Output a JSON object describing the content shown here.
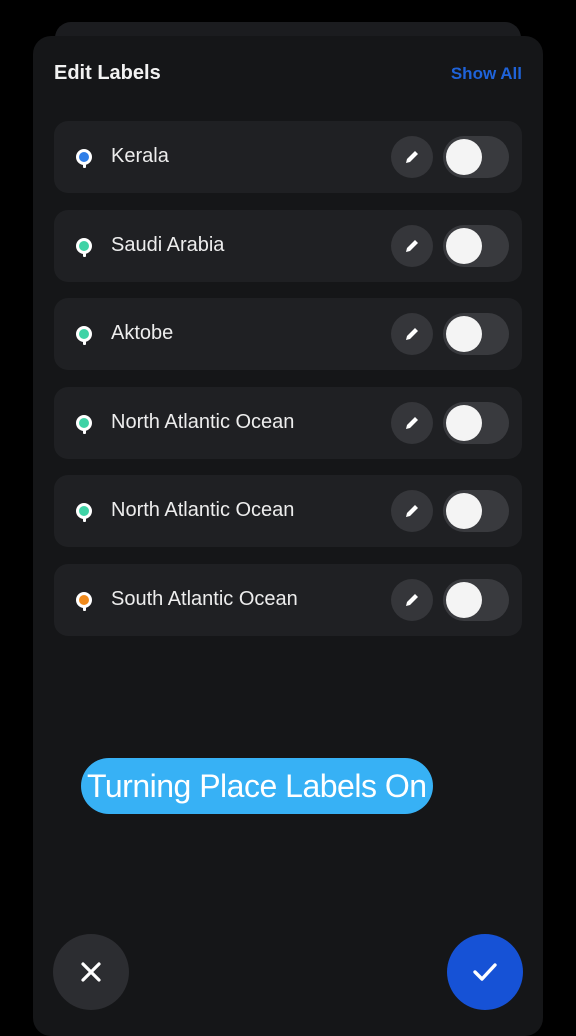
{
  "header": {
    "title": "Edit Labels",
    "show_all_label": "Show All"
  },
  "labels": [
    {
      "name": "Kerala",
      "marker_color": "#2f7ee8",
      "enabled": false
    },
    {
      "name": "Saudi Arabia",
      "marker_color": "#3fd3a6",
      "enabled": false
    },
    {
      "name": "Aktobe",
      "marker_color": "#3fd3a6",
      "enabled": false
    },
    {
      "name": "North Atlantic Ocean",
      "marker_color": "#3fd3a6",
      "enabled": false
    },
    {
      "name": "North Atlantic Ocean",
      "marker_color": "#3fd3a6",
      "enabled": false
    },
    {
      "name": "South Atlantic Ocean",
      "marker_color": "#f08a1c",
      "enabled": false
    }
  ],
  "caption": "Turning Place Labels On",
  "icons": {
    "edit": "pencil-icon",
    "cancel": "close-icon",
    "confirm": "checkmark-icon"
  },
  "colors": {
    "accent": "#1652d6",
    "link": "#1f63d9",
    "caption_bg": "#37b1f5"
  }
}
